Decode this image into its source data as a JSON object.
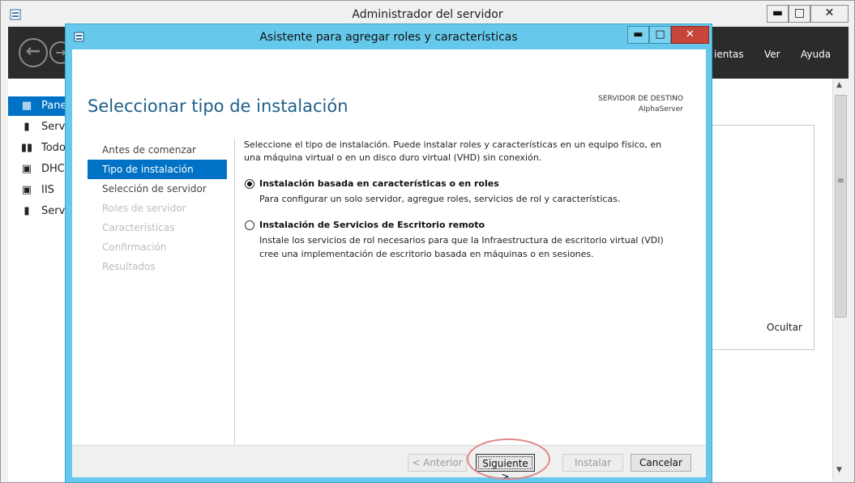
{
  "outer_window": {
    "title": "Administrador del servidor",
    "controls": {
      "minimize": "▬",
      "maximize": "□",
      "close": "✕"
    },
    "nav": {
      "back_glyph": "←",
      "forward_glyph": "→",
      "menus": [
        "ientas",
        "Ver",
        "Ayuda"
      ]
    },
    "sidebar": {
      "items": [
        {
          "label": "Pane",
          "icon": "dashboard-icon",
          "glyph": "▦",
          "active": true
        },
        {
          "label": "Servi",
          "icon": "server-icon",
          "glyph": "▮",
          "active": false
        },
        {
          "label": "Todo",
          "icon": "all-servers-icon",
          "glyph": "▮▮",
          "active": false
        },
        {
          "label": "DHC",
          "icon": "dhcp-icon",
          "glyph": "▣",
          "active": false
        },
        {
          "label": "IIS",
          "icon": "iis-icon",
          "glyph": "▣",
          "active": false
        },
        {
          "label": "Servi",
          "icon": "services-icon",
          "glyph": "▮",
          "active": false
        }
      ]
    },
    "hide_label": "Ocultar",
    "scrollbar": {
      "up": "▲",
      "grip": "≡",
      "down": "▼"
    }
  },
  "dialog": {
    "title": "Asistente para agregar roles y características",
    "controls": {
      "minimize": "▬",
      "maximize": "□",
      "close": "✕"
    },
    "heading": "Seleccionar tipo de instalación",
    "destination_label": "SERVIDOR DE DESTINO",
    "destination_server": "AlphaServer",
    "steps": [
      {
        "label": "Antes de comenzar",
        "state": "normal"
      },
      {
        "label": "Tipo de instalación",
        "state": "active"
      },
      {
        "label": "Selección de servidor",
        "state": "normal"
      },
      {
        "label": "Roles de servidor",
        "state": "disabled"
      },
      {
        "label": "Características",
        "state": "disabled"
      },
      {
        "label": "Confirmación",
        "state": "disabled"
      },
      {
        "label": "Resultados",
        "state": "disabled"
      }
    ],
    "intro": "Seleccione el tipo de instalación. Puede instalar roles y características en un equipo físico, en una máquina virtual o en un disco duro virtual (VHD) sin conexión.",
    "options": [
      {
        "title": "Instalación basada en características o en roles",
        "description": "Para configurar un solo servidor, agregue roles, servicios de rol y características.",
        "selected": true
      },
      {
        "title": "Instalación de Servicios de Escritorio remoto",
        "description": "Instale los servicios de rol necesarios para que la Infraestructura de escritorio virtual (VDI) cree una implementación de escritorio basada en máquinas o en sesiones.",
        "selected": false
      }
    ],
    "buttons": {
      "previous": "< Anterior",
      "next": "Siguiente >",
      "install": "Instalar",
      "cancel": "Cancelar"
    }
  }
}
